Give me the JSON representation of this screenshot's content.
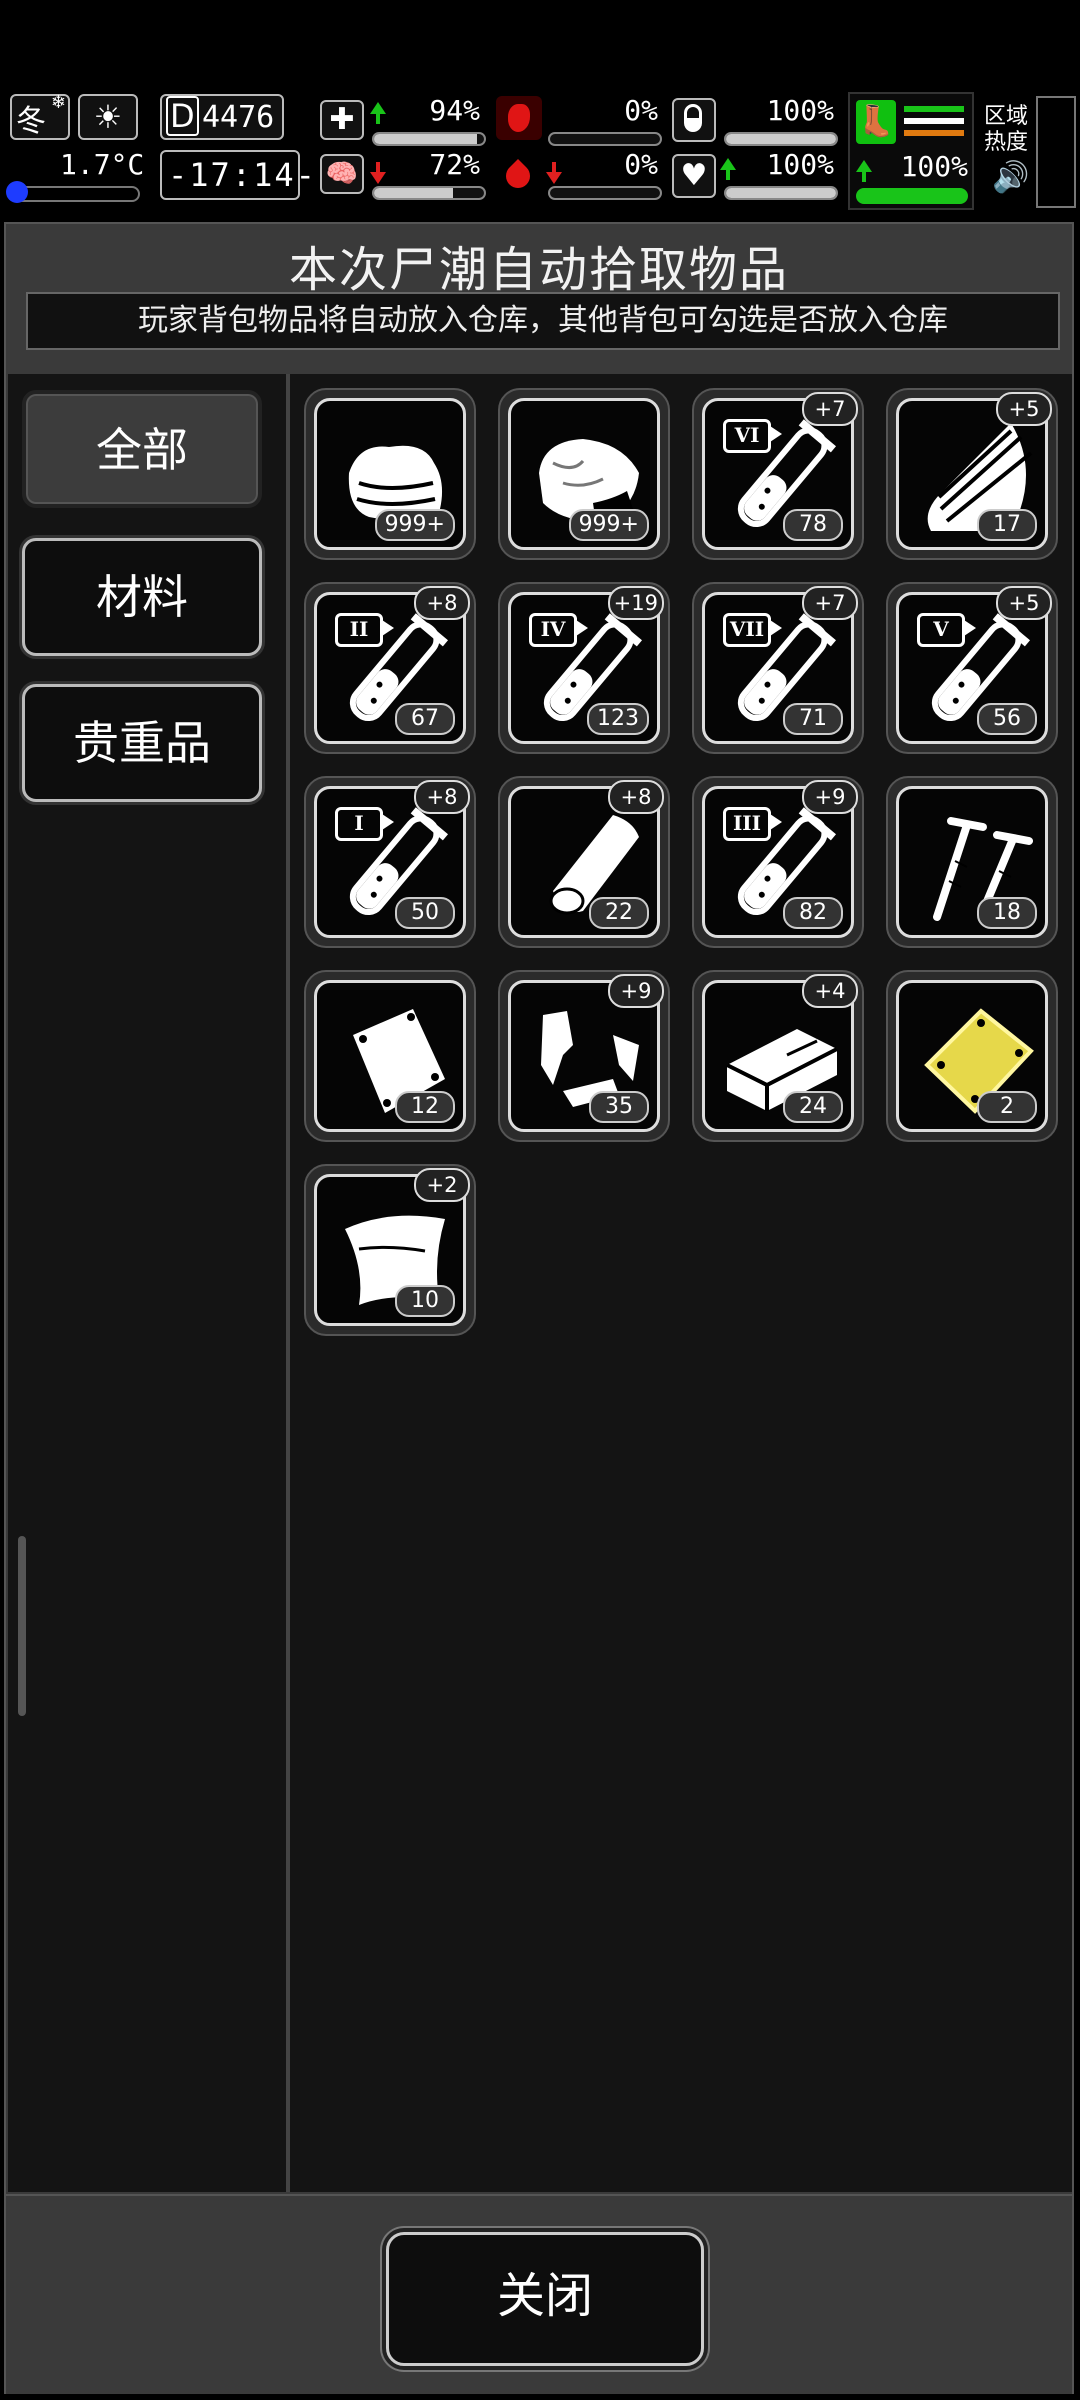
{
  "status": {
    "season": "冬",
    "temperature": "1.7°C",
    "day": "4476",
    "day_prefix": "D",
    "clock": "-17:14-",
    "region_heat": "区域\n热度",
    "stats": [
      {
        "id": "health",
        "value": "94%",
        "trend": "up",
        "fill": 0.94,
        "icon": "medkit-icon"
      },
      {
        "id": "sanity",
        "value": "72%",
        "trend": "down",
        "fill": 0.72,
        "icon": "brain-icon"
      },
      {
        "id": "hunger",
        "value": "0%",
        "trend": "none",
        "fill": 0,
        "icon": "stomach-icon"
      },
      {
        "id": "thirst",
        "value": "0%",
        "trend": "down",
        "fill": 0,
        "icon": "blood-drop-icon"
      },
      {
        "id": "pill",
        "value": "100%",
        "trend": "none",
        "fill": 1,
        "icon": "pill-icon"
      },
      {
        "id": "heart",
        "value": "100%",
        "trend": "up",
        "fill": 1,
        "icon": "heart-icon"
      },
      {
        "id": "stamina",
        "value": "100%",
        "trend": "up",
        "fill": 1,
        "icon": "boot-icon"
      }
    ]
  },
  "panel": {
    "title": "本次尸潮自动拾取物品",
    "subtitle": "玩家背包物品将自动放入仓库，其他背包可勾选是否放入仓库"
  },
  "tabs": [
    {
      "label": "全部",
      "active": true
    },
    {
      "label": "材料",
      "active": false
    },
    {
      "label": "贵重品",
      "active": false
    }
  ],
  "items": [
    {
      "icon": "cloth-pile-icon",
      "count": "999+",
      "bonus": "",
      "roman": ""
    },
    {
      "icon": "meat-chunk-icon",
      "count": "999+",
      "bonus": "",
      "roman": ""
    },
    {
      "icon": "test-tube-icon",
      "count": "78",
      "bonus": "+7",
      "roman": "VI"
    },
    {
      "icon": "wood-planks-icon",
      "count": "17",
      "bonus": "+5",
      "roman": ""
    },
    {
      "icon": "test-tube-icon",
      "count": "67",
      "bonus": "+8",
      "roman": "II"
    },
    {
      "icon": "test-tube-icon",
      "count": "123",
      "bonus": "+19",
      "roman": "IV"
    },
    {
      "icon": "test-tube-icon",
      "count": "71",
      "bonus": "+7",
      "roman": "VII"
    },
    {
      "icon": "test-tube-icon",
      "count": "56",
      "bonus": "+5",
      "roman": "V"
    },
    {
      "icon": "test-tube-icon",
      "count": "50",
      "bonus": "+8",
      "roman": "I"
    },
    {
      "icon": "leather-roll-icon",
      "count": "22",
      "bonus": "+8",
      "roman": ""
    },
    {
      "icon": "test-tube-icon",
      "count": "82",
      "bonus": "+9",
      "roman": "III"
    },
    {
      "icon": "screws-icon",
      "count": "18",
      "bonus": "",
      "roman": ""
    },
    {
      "icon": "metal-sheet-icon",
      "count": "12",
      "bonus": "",
      "roman": ""
    },
    {
      "icon": "scrap-pieces-icon",
      "count": "35",
      "bonus": "+9",
      "roman": ""
    },
    {
      "icon": "brick-icon",
      "count": "24",
      "bonus": "+4",
      "roman": ""
    },
    {
      "icon": "gold-plate-icon",
      "count": "2",
      "bonus": "",
      "roman": ""
    },
    {
      "icon": "cloth-sheet-icon",
      "count": "10",
      "bonus": "+2",
      "roman": ""
    }
  ],
  "close_label": "关闭"
}
